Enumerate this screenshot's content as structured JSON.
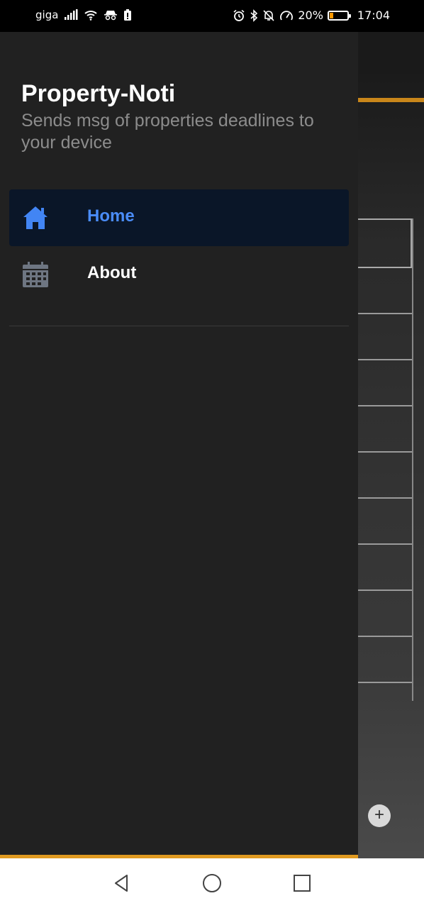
{
  "status_bar": {
    "carrier": "giga",
    "battery_percent": "20%",
    "battery_level": 0.2,
    "time": "17:04"
  },
  "drawer": {
    "title": "Property-Noti",
    "subtitle": "Sends msg of properties deadlines to your device",
    "items": [
      {
        "label": "Home",
        "icon": "home-icon",
        "active": true
      },
      {
        "label": "About",
        "icon": "calendar-icon",
        "active": false
      }
    ]
  },
  "colors": {
    "accent_orange": "#e09a20",
    "active_blue": "#4285f4",
    "drawer_bg": "#212121"
  },
  "nav_bar": {
    "buttons": [
      "back-icon",
      "home-circle-icon",
      "recents-icon"
    ]
  }
}
